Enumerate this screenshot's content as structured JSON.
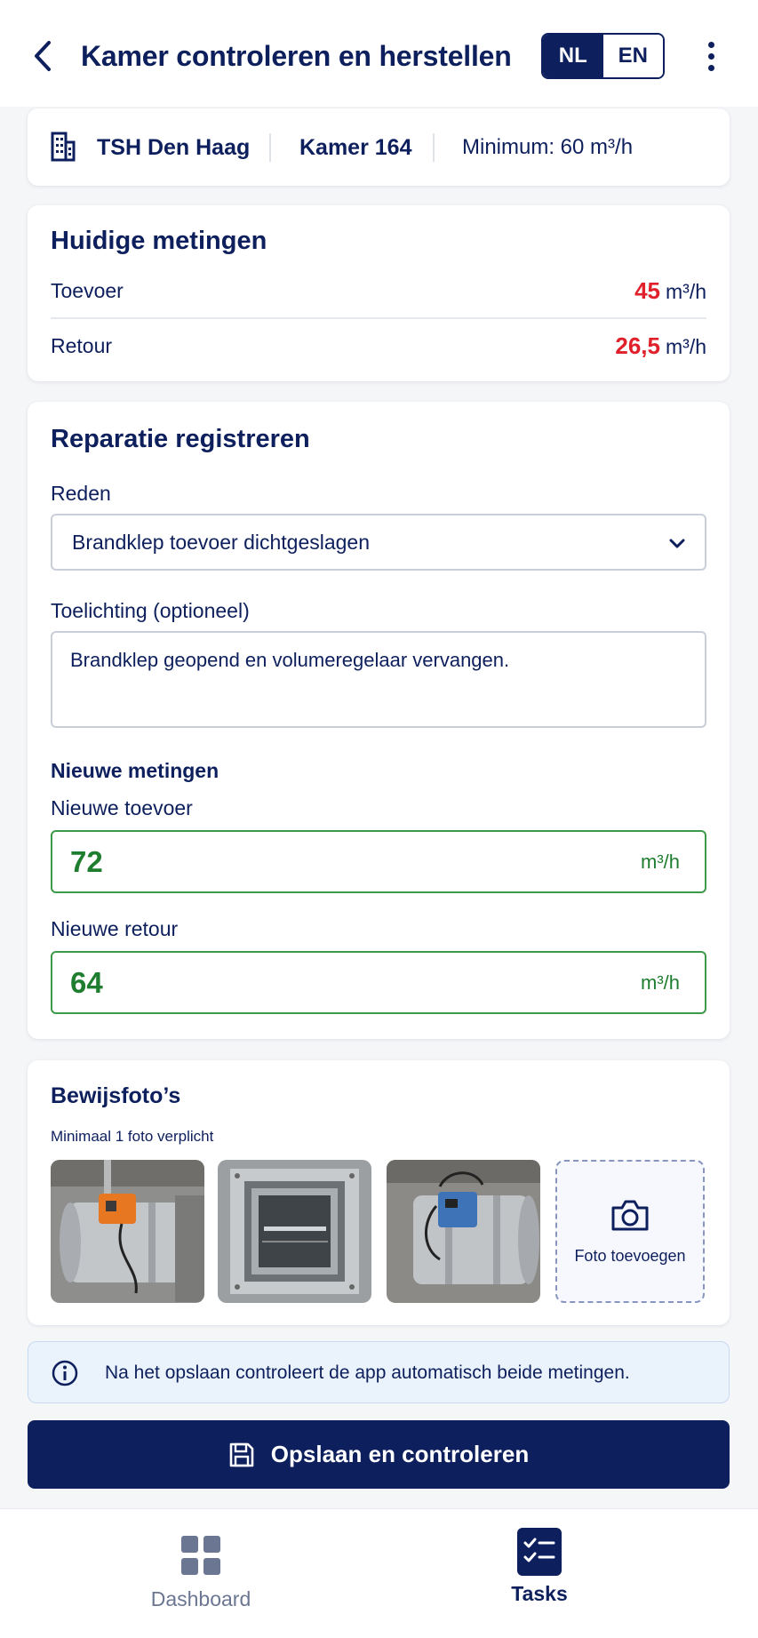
{
  "header": {
    "title": "Kamer controleren en herstellen",
    "lang_nl": "NL",
    "lang_en": "EN",
    "active_lang": "NL"
  },
  "info_bar": {
    "location": "TSH Den Haag",
    "room": "Kamer 164",
    "minimum": "Minimum: 60 m³/h"
  },
  "current_measurements": {
    "title": "Huidige metingen",
    "rows": [
      {
        "label": "Toevoer",
        "value": "45",
        "unit": "m³/h"
      },
      {
        "label": "Retour",
        "value": "26,5",
        "unit": "m³/h"
      }
    ]
  },
  "repair": {
    "title": "Reparatie registreren",
    "reason_label": "Reden",
    "reason_value": "Brandklep toevoer dichtgeslagen",
    "note_label": "Toelichting (optioneel)",
    "note_value": "Brandklep geopend en volumeregelaar vervangen.",
    "new_title": "Nieuwe metingen",
    "supply_label": "Nieuwe toevoer",
    "supply_value": "72",
    "supply_unit": "m³/h",
    "return_label": "Nieuwe retour",
    "return_value": "64",
    "return_unit": "m³/h"
  },
  "photos": {
    "title": "Bewijsfoto’s",
    "subtitle": "Minimaal 1 foto verplicht",
    "add_label": "Foto toevoegen"
  },
  "notice": {
    "text": "Na het opslaan controleert de app automatisch beide metingen."
  },
  "save_button": {
    "label": "Opslaan en controleren"
  },
  "bottom_nav": {
    "items": [
      {
        "label": "Dashboard",
        "active": false
      },
      {
        "label": "Tasks",
        "active": true
      }
    ]
  },
  "colors": {
    "primary": "#0d1f5c",
    "warning_value": "#e0202a",
    "ok_value": "#1e7d2e",
    "ok_border": "#3d9a4a",
    "notice_bg": "#eaf2fc"
  }
}
